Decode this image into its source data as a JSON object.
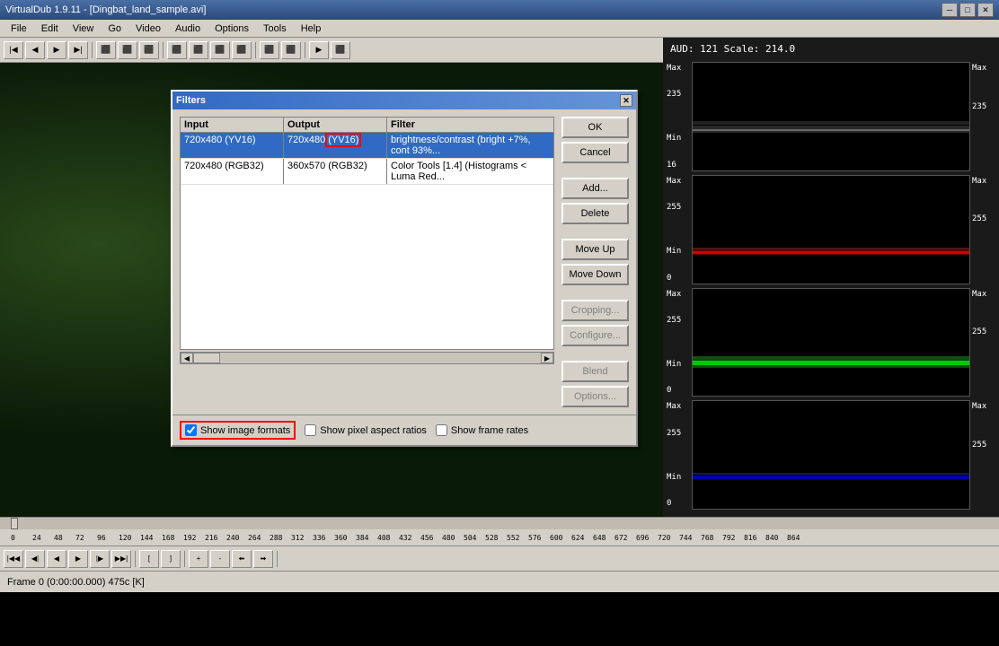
{
  "titlebar": {
    "title": "VirtualDub 1.9.11 - [Dingbat_land_sample.avi]",
    "min_btn": "─",
    "max_btn": "□",
    "close_btn": "✕"
  },
  "menubar": {
    "items": [
      "File",
      "Edit",
      "View",
      "Go",
      "Video",
      "Audio",
      "Options",
      "Tools",
      "Help"
    ]
  },
  "scope": {
    "header": "AUD: 121    Scale: 214.0",
    "charts": [
      {
        "name": "white-chart",
        "color": "#ffffff",
        "min_label": "Min\n16",
        "max_label": "Max\n235"
      },
      {
        "name": "red-chart",
        "color": "#ff0000",
        "min_label": "Min\n0",
        "max_label": "Max\n255"
      },
      {
        "name": "green-chart",
        "color": "#00ff00",
        "min_label": "Min\n0",
        "max_label": "Max\n255"
      },
      {
        "name": "blue-chart",
        "color": "#0055ff",
        "min_label": "Min\n0",
        "max_label": "Max\n255"
      }
    ]
  },
  "dialog": {
    "title": "Filters",
    "close_btn": "✕",
    "table": {
      "headers": [
        "Input",
        "Output",
        "Filter"
      ],
      "rows": [
        {
          "input": "720x480 (YV16)",
          "output_text": "720x480",
          "output_format": "(YV16)",
          "filter": "brightness/contrast (bright +7%, cont 93%..."
        },
        {
          "input": "720x480 (RGB32)",
          "output_text": "360x570 (RGB32)",
          "output_format": "",
          "filter": "Color Tools [1.4] (Histograms < Luma Red..."
        }
      ]
    },
    "buttons": {
      "ok": "OK",
      "cancel": "Cancel",
      "add": "Add...",
      "delete": "Delete",
      "move_up": "Move Up",
      "move_down": "Move Down",
      "cropping": "Cropping...",
      "configure": "Configure...",
      "blend": "Blend",
      "options": "Options..."
    },
    "footer": {
      "show_image_formats_label": "Show image formats",
      "show_image_formats_checked": true,
      "show_pixel_ratios_label": "Show pixel aspect ratios",
      "show_pixel_ratios_checked": false,
      "show_frame_rates_label": "Show frame rates",
      "show_frame_rates_checked": false
    }
  },
  "statusbar": {
    "text": "Frame 0 (0:00:00.000) 475c [K]"
  },
  "timeline": {
    "ticks": [
      "0",
      "",
      "24",
      "",
      "48",
      "",
      "72",
      "",
      "96",
      "",
      "120",
      "",
      "144",
      "",
      "168",
      "",
      "192",
      "",
      "216",
      "",
      "240",
      "",
      "264",
      "",
      "288",
      "",
      "312",
      "",
      "336",
      "",
      "360",
      "",
      "384",
      "",
      "408",
      "",
      "432",
      "",
      "456",
      "",
      "480",
      "",
      "504",
      "",
      "528",
      "",
      "552",
      "",
      "576",
      "",
      "600",
      "",
      "624",
      "",
      "648",
      "",
      "672",
      "",
      "696",
      "",
      "720",
      "",
      "744",
      "",
      "768",
      "",
      "792",
      "",
      "816",
      "",
      "840",
      "",
      "864"
    ]
  },
  "toolbar": {
    "buttons": [
      "◀◀",
      "◀",
      "▶",
      "▶▶",
      "⬛",
      "⬛",
      "⬛",
      "⬛",
      "⬛",
      "⬛",
      "⬛",
      "⬛",
      "⬛",
      "⬛",
      "⬛",
      "⬛",
      "⬛",
      "⬛",
      "⬛",
      "⬛",
      "⬛"
    ]
  }
}
